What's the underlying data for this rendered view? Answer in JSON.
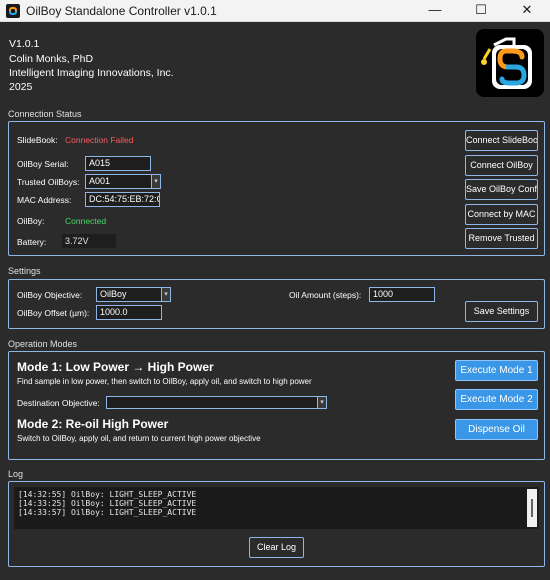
{
  "window": {
    "title": "OilBoy Standalone Controller v1.0.1",
    "minimize": "—",
    "maximize": "☐",
    "close": "✕"
  },
  "about": {
    "version": "V1.0.1",
    "author": "Colin Monks, PhD",
    "company": "Intelligent Imaging Innovations, Inc.",
    "year": "2025"
  },
  "connection": {
    "header": "Connection Status",
    "slidebook_label": "SlideBook:",
    "slidebook_status": "Connection Failed",
    "serial_label": "OilBoy Serial:",
    "serial_value": "A015",
    "trusted_label": "Trusted OilBoys:",
    "trusted_value": "A001",
    "mac_label": "MAC Address:",
    "mac_value": "DC:54:75:EB:72:C5",
    "oilboy_label": "OilBoy:",
    "oilboy_status": "Connected",
    "battery_label": "Battery:",
    "battery_value": "3.72V",
    "buttons": {
      "connect_slidebook": "Connect SlideBoo",
      "connect_oilboy": "Connect OilBoy",
      "save_oilboy_conf": "Save OilBoy Conf",
      "connect_by_mac": "Connect by MAC",
      "remove_trusted": "Remove Trusted"
    },
    "colors": {
      "failed": "#ff5a5a",
      "connected": "#4cd964"
    }
  },
  "settings": {
    "header": "Settings",
    "objective_label": "OilBoy Objective:",
    "objective_value": "OilBoy",
    "offset_label": "OilBoy Offset (µm):",
    "offset_value": "1000.0",
    "oil_amount_label": "Oil Amount (steps):",
    "oil_amount_value": "1000",
    "save_button": "Save Settings"
  },
  "operation": {
    "header": "Operation Modes",
    "mode1_title": "Mode 1: Low Power → High Power",
    "mode1_desc": "Find sample in low power, then switch to OilBoy, apply oil, and switch to high power",
    "dest_label": "Destination Objective:",
    "dest_value": "",
    "mode2_title": "Mode 2: Re-oil High Power",
    "mode2_desc": "Switch to OilBoy, apply oil, and return to current high power objective",
    "execute_mode1": "Execute Mode 1",
    "execute_mode2": "Execute Mode 2",
    "dispense_oil": "Dispense Oil"
  },
  "log": {
    "header": "Log",
    "lines": [
      "[14:32:55] OilBoy: LIGHT_SLEEP_ACTIVE",
      "[14:33:25] OilBoy: LIGHT_SLEEP_ACTIVE",
      "[14:33:57] OilBoy: LIGHT_SLEEP_ACTIVE"
    ],
    "clear_button": "Clear Log"
  },
  "icons": {
    "app": "oilboy-app-icon",
    "logo": "oilboy-logo-icon",
    "dropdown": "chevron-down-icon"
  }
}
